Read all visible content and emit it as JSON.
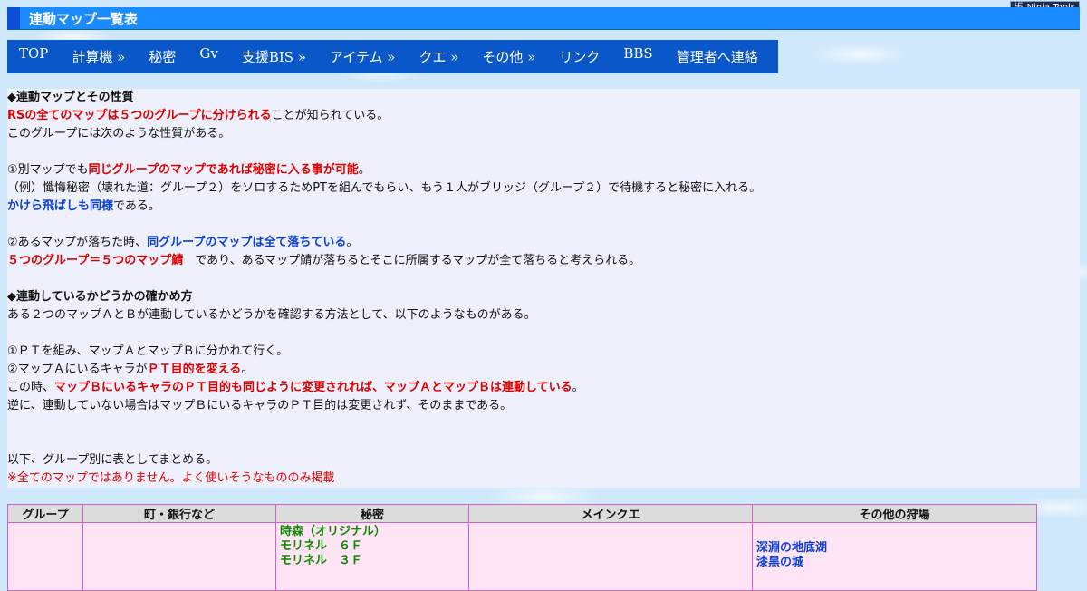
{
  "widget": {
    "label": "Ninja Tools"
  },
  "page": {
    "title": "連動マップ一覧表"
  },
  "nav": [
    {
      "label": "TOP"
    },
    {
      "label": "計算機 »"
    },
    {
      "label": "秘密"
    },
    {
      "label": "Gv"
    },
    {
      "label": "支援BIS »"
    },
    {
      "label": "アイテム »"
    },
    {
      "label": "クエ »"
    },
    {
      "label": "その他 »"
    },
    {
      "label": "リンク"
    },
    {
      "label": "BBS"
    },
    {
      "label": "管理者へ連絡"
    }
  ],
  "content": {
    "h1": "◆連動マップとその性質",
    "l1_red": "RSの全てのマップは５つのグループに分けられる",
    "l1_rest": "ことが知られている。",
    "l2": "このグループには次のような性質がある。",
    "l4_pre": "①別マップでも",
    "l4_red": "同じグループのマップであれば秘密に入る事が可能",
    "l4_post": "。",
    "l5": "（例）懺悔秘密（壊れた道：グループ２）をソロするためPTを組んでもらい、もう１人がブリッジ（グループ２）で待機すると秘密に入れる。",
    "l6_blue": "かけら飛ばしも同様",
    "l6_rest": "である。",
    "l8_pre": "②あるマップが落ちた時、",
    "l8_blue": "同グループのマップは全て落ちている",
    "l8_post": "。",
    "l9_red": "５つのグループ＝５つのマップ鯖",
    "l9_rest": "　であり、あるマップ鯖が落ちるとそこに所属するマップが全て落ちると考えられる。",
    "h2": "◆連動しているかどうかの確かめ方",
    "l12": "ある２つのマップＡとＢが連動しているかどうかを確認する方法として、以下のようなものがある。",
    "l14": "①ＰＴを組み、マップＡとマップＢに分かれて行く。",
    "l15_pre": "②マップＡにいるキャラが",
    "l15_red": "ＰＴ目的を変える",
    "l15_post": "。",
    "l16_pre": "この時、",
    "l16_red": "マップＢにいるキャラのＰＴ目的も同じように変更されれば、マップＡとマップＢは連動している",
    "l16_post": "。",
    "l17": "逆に、連動していない場合はマップＢにいるキャラのＰＴ目的は変更されず、そのままである。",
    "l21": "以下、グループ別に表としてまとめる。",
    "l22": "※全てのマップではありません。よく使いそうなもののみ掲載"
  },
  "table": {
    "headers": [
      "グループ",
      "町・銀行など",
      "秘密",
      "メインクエ",
      "その他の狩場"
    ],
    "secret_items": [
      "時森（オリジナル）",
      "モリネル　６Ｆ",
      "モリネル　３Ｆ"
    ],
    "hunt_items": [
      "深淵の地底湖",
      "漆黒の城"
    ]
  }
}
